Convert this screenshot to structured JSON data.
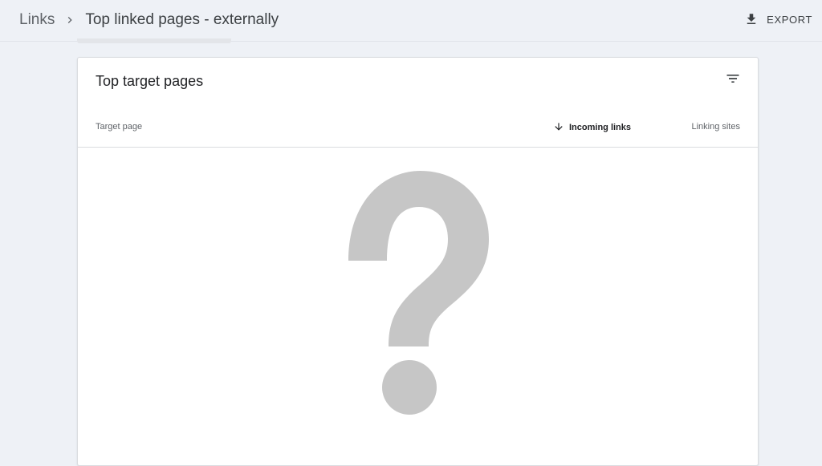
{
  "header": {
    "breadcrumb_root": "Links",
    "breadcrumb_current": "Top linked pages - externally",
    "export_label": "EXPORT",
    "icons": {
      "separator": "chevron-right-icon",
      "export": "download-icon"
    }
  },
  "card": {
    "title": "Top target pages",
    "filter_icon": "filter-icon",
    "columns": {
      "target_page": "Target page",
      "incoming_links": "Incoming links",
      "linking_sites": "Linking sites"
    },
    "sort": {
      "column": "incoming_links",
      "direction": "descending",
      "icon": "arrow-down-icon"
    },
    "placeholder_icon": "question-mark-icon",
    "colors": {
      "placeholder": "#c6c6c6",
      "background": "#eef1f6"
    }
  }
}
